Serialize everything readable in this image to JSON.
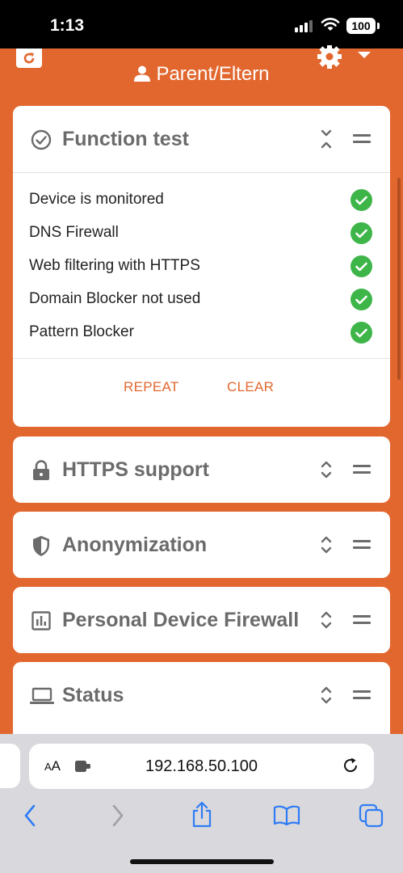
{
  "status_bar": {
    "time": "1:13",
    "battery": "100"
  },
  "header": {
    "profile_name": "Parent/Eltern"
  },
  "cards": {
    "function_test": {
      "title": "Function test",
      "tests": [
        {
          "label": "Device is monitored",
          "status": "ok"
        },
        {
          "label": "DNS Firewall",
          "status": "ok"
        },
        {
          "label": "Web filtering with HTTPS",
          "status": "ok"
        },
        {
          "label": "Domain Blocker not used",
          "status": "ok"
        },
        {
          "label": "Pattern Blocker",
          "status": "ok"
        }
      ],
      "repeat_label": "REPEAT",
      "clear_label": "CLEAR"
    },
    "https": {
      "title": "HTTPS support"
    },
    "anonymization": {
      "title": "Anonymization"
    },
    "firewall": {
      "title": "Personal Device Firewall"
    },
    "status": {
      "title": "Status"
    }
  },
  "browser": {
    "url": "192.168.50.100",
    "aa_label": "A",
    "aa_label_big": "A"
  },
  "colors": {
    "accent": "#e2672f",
    "check": "#3eb549",
    "text_muted": "#6b6b6b",
    "ios_blue": "#2f7cf6"
  }
}
